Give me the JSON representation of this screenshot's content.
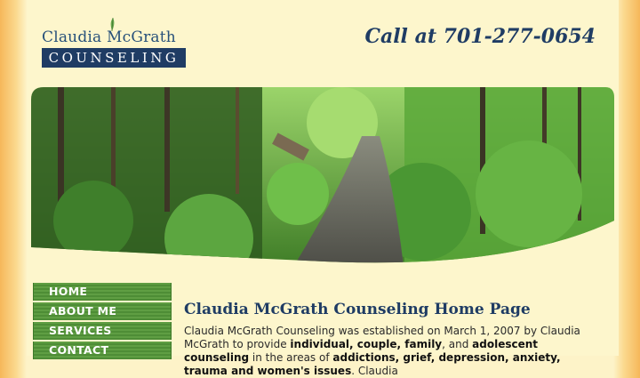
{
  "logo": {
    "top_text": "Claudia McGrath",
    "bottom_text": "COUNSELING"
  },
  "header": {
    "phone": "Call at 701-277-0654"
  },
  "hero": {
    "alt": "forest trail"
  },
  "nav": {
    "items": [
      {
        "label": "HOME"
      },
      {
        "label": "ABOUT ME"
      },
      {
        "label": "SERVICES"
      },
      {
        "label": "CONTACT"
      }
    ]
  },
  "main": {
    "title": "Claudia McGrath Counseling Home Page",
    "intro": {
      "t1": "Claudia McGrath Counseling was established on March 1, 2007 by Claudia McGrath to provide ",
      "b1": "individual, couple, family",
      "t2": ", and ",
      "b2": "adolescent counseling",
      "t3": " in the areas of ",
      "b3": "addictions, grief, depression, anxiety, trauma and women's issues",
      "t4": ". Claudia"
    }
  },
  "colors": {
    "navy": "#1f3c64",
    "nav_green": "#5f9e43",
    "page_bg": "#fdf6cc",
    "side_orange": "#f6b75a"
  }
}
